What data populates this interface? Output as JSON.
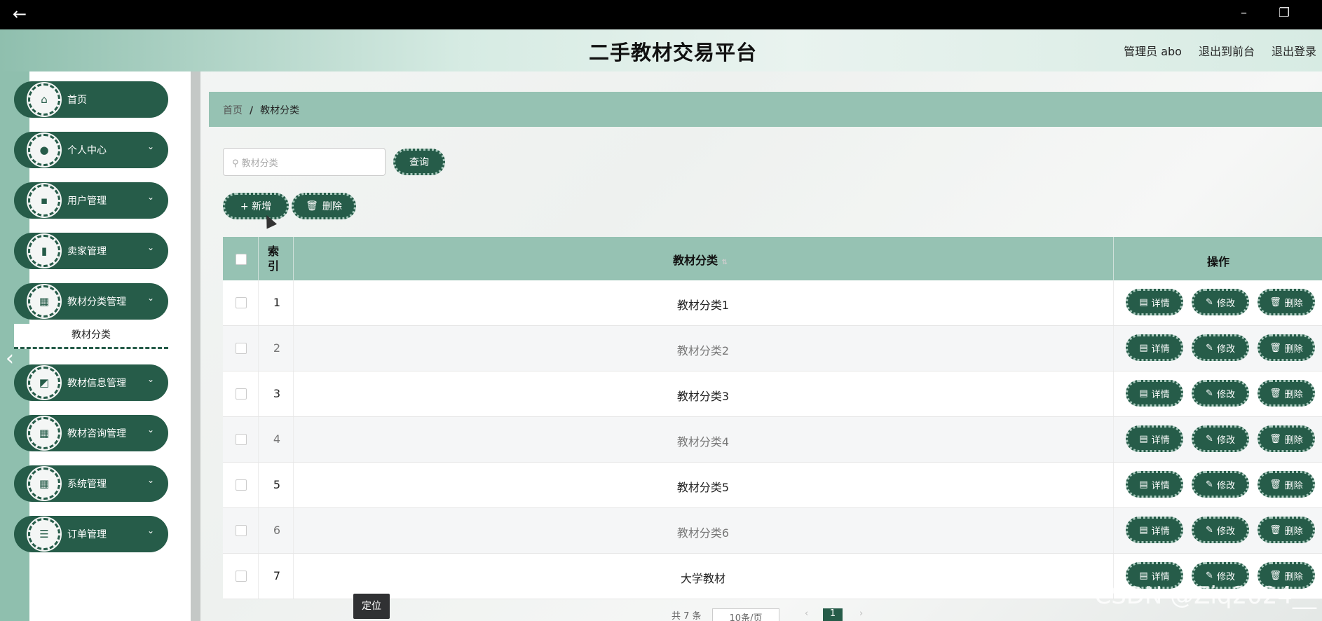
{
  "window": {
    "back_icon": "arrow-left-icon",
    "minimize": "–",
    "restore": "❐"
  },
  "header": {
    "title": "二手教材交易平台",
    "user": "管理员 abo",
    "to_front": "退出到前台",
    "logout": "退出登录"
  },
  "sidebar": {
    "items": [
      {
        "label": "首页",
        "icon": "home-icon",
        "glyph": "⌂"
      },
      {
        "label": "个人中心",
        "icon": "user-icon",
        "glyph": "●"
      },
      {
        "label": "用户管理",
        "icon": "chat-icon",
        "glyph": "▪"
      },
      {
        "label": "卖家管理",
        "icon": "book-icon",
        "glyph": "▮"
      },
      {
        "label": "教材分类管理",
        "icon": "grid-icon",
        "glyph": "▦"
      },
      {
        "label": "教材信息管理",
        "icon": "chart-icon",
        "glyph": "◩"
      },
      {
        "label": "教材咨询管理",
        "icon": "grid-icon",
        "glyph": "▦"
      },
      {
        "label": "系统管理",
        "icon": "grid-icon",
        "glyph": "▦"
      },
      {
        "label": "订单管理",
        "icon": "list-icon",
        "glyph": "☰"
      }
    ],
    "submenu_label": "教材分类"
  },
  "breadcrumb": {
    "home": "首页",
    "sep": "/",
    "current": "教材分类"
  },
  "search": {
    "placeholder": "教材分类",
    "query_label": "查询"
  },
  "toolbar": {
    "add_label": "+ 新增",
    "delete_label": "删除"
  },
  "table": {
    "headers": {
      "index": "索引",
      "category": "教材分类",
      "sort_icon": "sort-icon",
      "actions": "操作"
    },
    "rows": [
      {
        "index": "1",
        "category": "教材分类1"
      },
      {
        "index": "2",
        "category": "教材分类2"
      },
      {
        "index": "3",
        "category": "教材分类3"
      },
      {
        "index": "4",
        "category": "教材分类4"
      },
      {
        "index": "5",
        "category": "教材分类5"
      },
      {
        "index": "6",
        "category": "教材分类6"
      },
      {
        "index": "7",
        "category": "大学教材"
      }
    ],
    "actions": {
      "detail": "详情",
      "edit": "修改",
      "delete": "删除"
    }
  },
  "tooltip": "定位",
  "pagination": {
    "total": "共 7 条",
    "page_size": "10条/页",
    "current_page": "1"
  },
  "watermark": "CSDN @Ziq2024__",
  "colors": {
    "primary": "#265c49",
    "header_teal": "#96c2b3"
  }
}
